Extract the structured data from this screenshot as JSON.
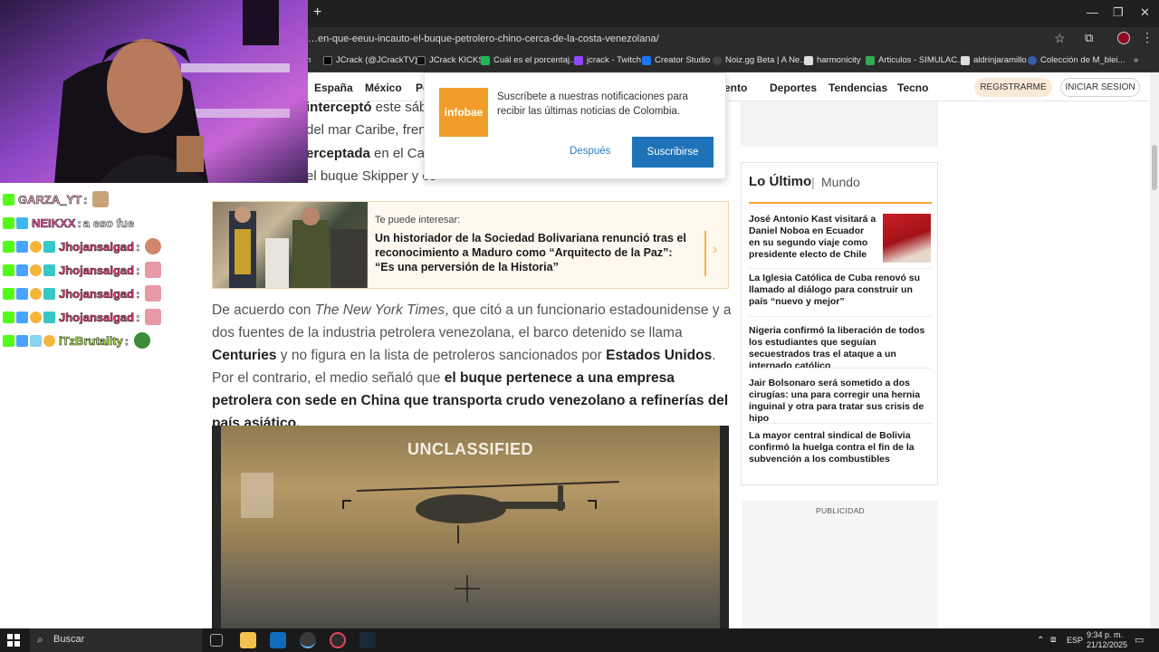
{
  "browser": {
    "url": "…en-que-eeuu-incauto-el-buque-petrolero-chino-cerca-de-la-costa-venezolana/",
    "bookmarks": [
      {
        "label": "JCrack (@JCrackTV)...",
        "color": "#000000"
      },
      {
        "label": "JCrack KICKS",
        "color": "#111111"
      },
      {
        "label": "Cuál es el porcentaj...",
        "color": "#1db954"
      },
      {
        "label": "jcrack - Twitch",
        "color": "#9146ff"
      },
      {
        "label": "Creator Studio",
        "color": "#1877f2"
      },
      {
        "label": "Noiz.gg Beta | A Ne...",
        "color": "#222222"
      },
      {
        "label": "harmonicity",
        "color": "#dddddd"
      },
      {
        "label": "Articulos - SIMULAC...",
        "color": "#34a853"
      },
      {
        "label": "aldrinjaramillo",
        "color": "#dddddd"
      },
      {
        "label": "Colección de M_blei...",
        "color": "#3b5ba8"
      }
    ]
  },
  "site": {
    "nav": [
      "España",
      "México",
      "Pe",
      "miento",
      "Deportes",
      "Tendencias",
      "Tecno"
    ],
    "register": "REGISTRARME",
    "login": "INICIAR SESION"
  },
  "notification": {
    "logo": "infobae",
    "text": "Suscríbete a nuestras notificaciones para recibir las últimas noticias de Colombia.",
    "later": "Después",
    "subscribe": "Suscribirse"
  },
  "article": {
    "lead_lines": [
      {
        "bold": "interceptó",
        "rest": " este sába"
      },
      {
        "bold": "",
        "rest": "del mar Caribe, frente"
      },
      {
        "bold": "erceptada",
        "rest": " en el Cari"
      },
      {
        "bold": "",
        "rest": "el buque Skipper y co"
      }
    ],
    "recommend": {
      "kicker": "Te puede interesar:",
      "title": "Un historiador de la Sociedad Bolivariana renunció tras el reconocimiento a Maduro como “Arquitecto de la Paz”: “Es una perversión de la Historia”"
    },
    "para": {
      "t1": "De acuerdo con ",
      "nyt": "The New York Times",
      "t2": ", que citó a un funcionario estadounidense y a dos fuentes de la industria petrolera venezolana, el barco detenido se llama ",
      "b1": "Centuries",
      "t3": " y no figura en la lista de petroleros sancionados por ",
      "b2": "Estados Unidos",
      "t4": ". Por el contrario, el medio señaló que ",
      "b3": "el buque pertenece a una empresa petrolera con sede en China que transporta crudo venezolano a refinerías del país asiático."
    },
    "video_label": "UNCLASSIFIED"
  },
  "sidebar": {
    "latest_title": "Lo Último",
    "latest_sep": "|",
    "latest_section": "Mundo",
    "items": [
      "José Antonio Kast visitará a Daniel Noboa en Ecuador en su segundo viaje como presidente electo de Chile",
      "La Iglesia Católica de Cuba renovó su llamado al diálogo para construir un país “nuevo y mejor”",
      "Nigeria confirmó la liberación de todos los estudiantes que seguían secuestrados tras el ataque a un internado católico",
      "Jair Bolsonaro será sometido a dos cirugías: una para corregir una hernia inguinal y otra para tratar sus crisis de hipo",
      "La mayor central sindical de Bolivia confirmó la huelga contra el fin de la subvención a los combustibles"
    ],
    "ad_label": "PUBLICIDAD"
  },
  "chat": [
    {
      "user": "GARZA_YT",
      "msg": "",
      "color": "#ffb6d9"
    },
    {
      "user": "NEIKXX",
      "msg": "a eso fue",
      "color": "#ff4fa8"
    },
    {
      "user": "Jhojansalgad",
      "msg": "",
      "color": "#ff3d7a"
    },
    {
      "user": "Jhojansalgad",
      "msg": "",
      "color": "#ff3d7a"
    },
    {
      "user": "Jhojansalgad",
      "msg": "",
      "color": "#ff3d7a"
    },
    {
      "user": "Jhojansalgad",
      "msg": "",
      "color": "#ff3d7a"
    },
    {
      "user": "iTzBrutality",
      "msg": "",
      "color": "#b5ff3d"
    }
  ],
  "taskbar": {
    "search": "Buscar",
    "lang": "ESP",
    "time": "9:34 p. m.",
    "date": "21/12/2025"
  }
}
